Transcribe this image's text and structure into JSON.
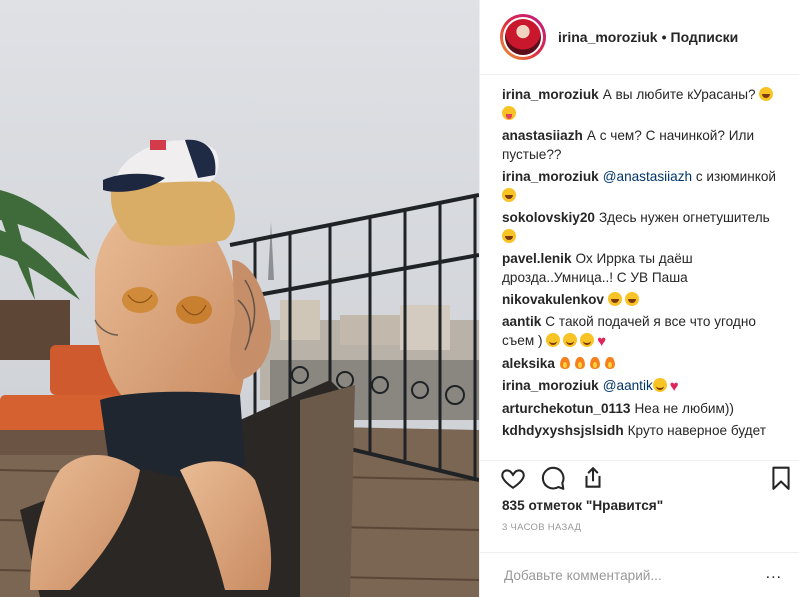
{
  "post": {
    "image_alt": "photo"
  },
  "header": {
    "username": "irina_moroziuk",
    "separator": "•",
    "follow_label": "Подписки"
  },
  "comments": [
    {
      "user": "irina_moroziuk",
      "text": "А вы любите кУрасаны?",
      "emoji": [
        "laugh",
        "tongue"
      ]
    },
    {
      "user": "anastasiiazh",
      "text": "А с чем? С начинкой? Или пустые??",
      "emoji": []
    },
    {
      "user": "irina_moroziuk",
      "mention": "@anastasiiazh",
      "text": " с изюминкой",
      "emoji": [
        "laugh"
      ]
    },
    {
      "user": "sokolovskiy20",
      "text": "Здесь нужен огнетушитель",
      "emoji": [
        "laugh"
      ]
    },
    {
      "user": "pavel.lenik",
      "text": "Ох Иррка ты даёш дрозда..Умница..! С УВ Паша",
      "emoji": []
    },
    {
      "user": "nikovakulenkov",
      "text": "",
      "emoji": [
        "laugh",
        "laugh"
      ]
    },
    {
      "user": "aantik",
      "text": "С такой подачей я все что угодно съем )",
      "emoji": [
        "smile",
        "smile",
        "smile",
        "heart"
      ]
    },
    {
      "user": "aleksika",
      "text": "",
      "emoji": [
        "fire",
        "fire",
        "fire",
        "fire"
      ]
    },
    {
      "user": "irina_moroziuk",
      "mention": "@aantik",
      "text": "",
      "emoji": [
        "smile",
        "heart"
      ]
    },
    {
      "user": "arturchekotun_0113",
      "text": "Неа не любим))",
      "emoji": []
    },
    {
      "user": "kdhdyxyshsjslsidh",
      "text": "Круто наверное будет",
      "emoji": []
    }
  ],
  "actions": {
    "like_icon": "heart-outline-icon",
    "comment_icon": "comment-icon",
    "share_icon": "share-icon",
    "save_icon": "bookmark-icon"
  },
  "likes_text": "835 отметок \"Нравится\"",
  "time_ago": "3 часов назад",
  "add_comment": {
    "placeholder": "Добавьте комментарий...",
    "more_label": "..."
  },
  "colors": {
    "text": "#262626",
    "secondary": "#999999",
    "mention": "#003569",
    "border": "#efefef"
  }
}
